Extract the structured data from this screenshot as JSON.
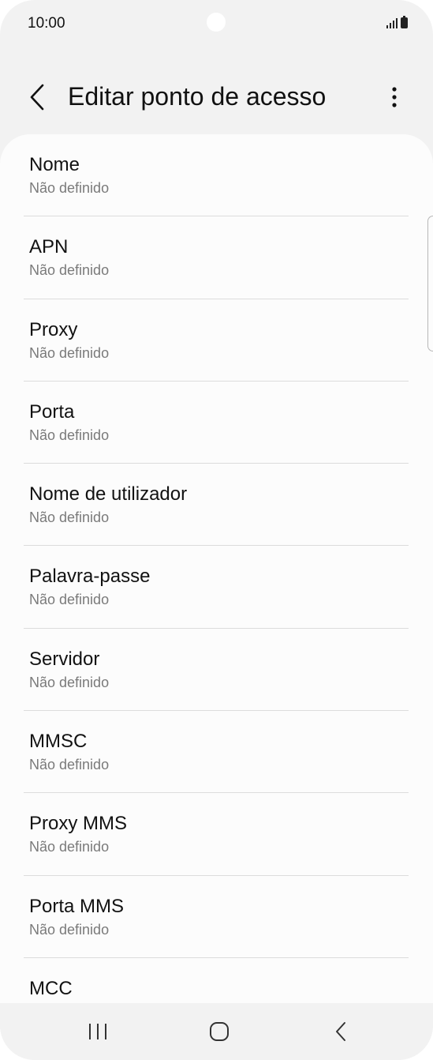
{
  "status_bar": {
    "time": "10:00",
    "icons": [
      "signal-icon",
      "battery-icon"
    ]
  },
  "app_bar": {
    "title": "Editar ponto de acesso",
    "back_icon": "chevron-left-icon",
    "more_icon": "more-vertical-icon"
  },
  "settings": {
    "items": [
      {
        "title": "Nome",
        "value": "Não definido"
      },
      {
        "title": "APN",
        "value": "Não definido"
      },
      {
        "title": "Proxy",
        "value": "Não definido"
      },
      {
        "title": "Porta",
        "value": "Não definido"
      },
      {
        "title": "Nome de utilizador",
        "value": "Não definido"
      },
      {
        "title": "Palavra-passe",
        "value": "Não definido"
      },
      {
        "title": "Servidor",
        "value": "Não definido"
      },
      {
        "title": "MMSC",
        "value": "Não definido"
      },
      {
        "title": "Proxy MMS",
        "value": "Não definido"
      },
      {
        "title": "Porta MMS",
        "value": "Não definido"
      },
      {
        "title": "MCC",
        "value": ""
      }
    ]
  },
  "nav_bar": {
    "icons": [
      "recent-apps-icon",
      "home-icon",
      "back-icon"
    ]
  },
  "colors": {
    "background": "#f2f2f2",
    "card": "#fcfcfc",
    "primary_text": "#121212",
    "secondary_text": "#7a7a7a",
    "divider": "#dcdcdc"
  }
}
